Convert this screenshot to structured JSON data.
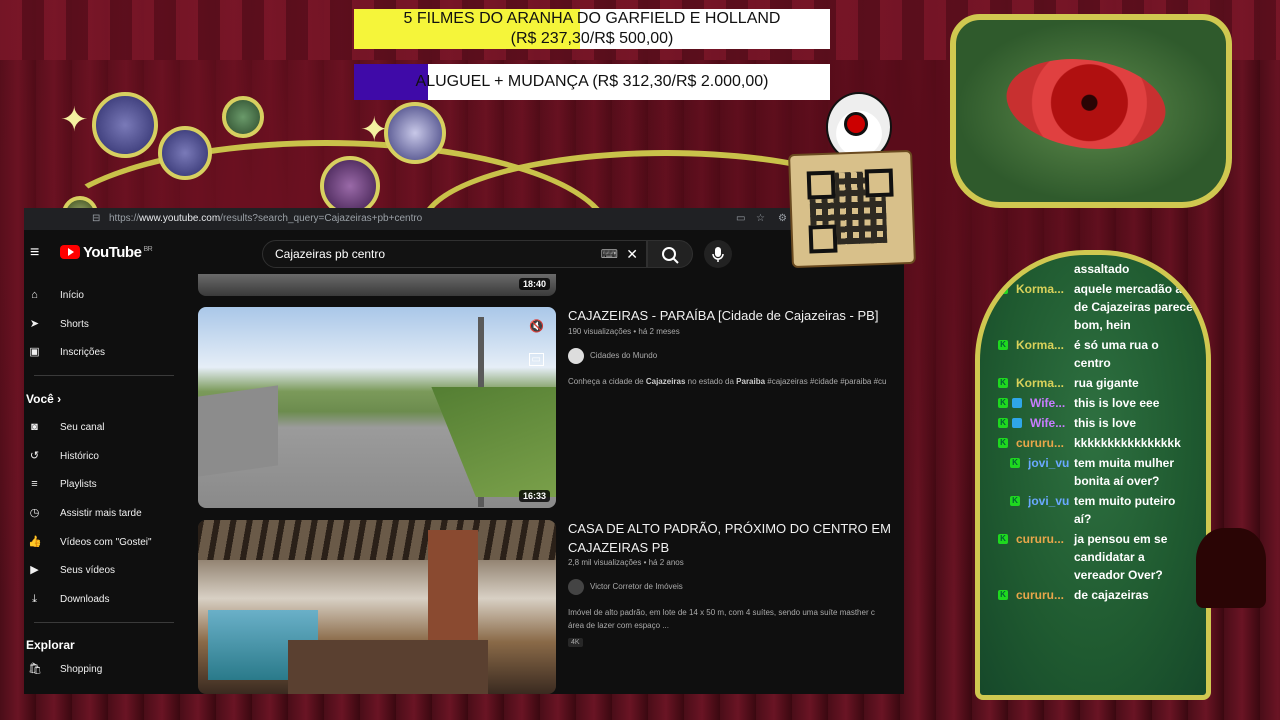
{
  "goals": [
    {
      "line1": "5 FILMES DO ARANHA DO GARFIELD E HOLLAND",
      "line2": "(R$ 237,30/R$ 500,00)",
      "progress": 0.4746,
      "color": "#f5f53a"
    },
    {
      "line1": "ALUGUEL + MUDANÇA (R$ 312,30/R$ 2.000,00)",
      "progress": 0.156,
      "color": "#3f0aa8"
    }
  ],
  "browser": {
    "url_prefix": "https://",
    "url_host": "www.youtube.com",
    "url_path": "/results?search_query=Cajazeiras+pb+centro"
  },
  "youtube": {
    "logo": "YouTube",
    "region": "BR",
    "search_value": "Cajazeiras pb centro",
    "sidebar": [
      {
        "icon": "home-icon",
        "glyph": "⌂",
        "label": "Início"
      },
      {
        "icon": "shorts-icon",
        "glyph": "➤",
        "label": "Shorts"
      },
      {
        "icon": "subscriptions-icon",
        "glyph": "▣",
        "label": "Inscrições"
      }
    ],
    "you_header": "Você",
    "you_items": [
      {
        "icon": "channel-icon",
        "glyph": "◙",
        "label": "Seu canal"
      },
      {
        "icon": "history-icon",
        "glyph": "↺",
        "label": "Histórico"
      },
      {
        "icon": "playlists-icon",
        "glyph": "≡",
        "label": "Playlists"
      },
      {
        "icon": "watch-later-icon",
        "glyph": "◷",
        "label": "Assistir mais tarde"
      },
      {
        "icon": "liked-icon",
        "glyph": "👍",
        "label": "Vídeos com \"Gostei\""
      },
      {
        "icon": "your-videos-icon",
        "glyph": "▶",
        "label": "Seus vídeos"
      },
      {
        "icon": "downloads-icon",
        "glyph": "⤓",
        "label": "Downloads"
      }
    ],
    "explore_header": "Explorar",
    "explore_items": [
      {
        "icon": "shopping-icon",
        "glyph": "🛍",
        "label": "Shopping"
      }
    ],
    "prev_duration": "18:40",
    "videos": [
      {
        "title": "CAJAZEIRAS - PARAÍBA [Cidade de Cajazeiras - PB]",
        "meta": "190 visualizações • há 2 meses",
        "channel": "Cidades do Mundo",
        "desc_pre": "Conheça a cidade de ",
        "desc_b1": "Cajazeiras",
        "desc_mid": " no estado da ",
        "desc_b2": "Paraiba",
        "desc_post": " #cajazeiras #cidade #paraiba #cu",
        "duration": "16:33"
      },
      {
        "title": "CASA DE ALTO PADRÃO, PRÓXIMO DO CENTRO EM CAJAZEIRAS PB",
        "meta": "2,8 mil visualizações • há 2 anos",
        "channel": "Victor Corretor de Imóveis",
        "desc_line1": "Imóvel de alto padrão, em lote de 14 x 50 m, com 4 suítes, sendo uma suíte masther c",
        "desc_line2": "área de lazer com espaço ...",
        "badge": "4K"
      }
    ]
  },
  "chat": [
    {
      "user": "",
      "text": "assaltado",
      "badges": 0,
      "color": "#ffffff"
    },
    {
      "user": "Korma...",
      "text": "aquele mercadão ali de Cajazeiras parece bom, hein",
      "badges": 1,
      "color": "#d9d15a"
    },
    {
      "user": "Korma...",
      "text": "é só uma rua o centro",
      "badges": 1,
      "color": "#d9d15a"
    },
    {
      "user": "Korma...",
      "text": "rua gigante",
      "badges": 1,
      "color": "#d9d15a"
    },
    {
      "user": "Wife...",
      "text": "this is love eee",
      "badges": 2,
      "color": "#c77dff"
    },
    {
      "user": "Wife...",
      "text": "this is love",
      "badges": 2,
      "color": "#c77dff"
    },
    {
      "user": "cururu...",
      "text": "kkkkkkkkkkkkkkkk",
      "badges": 1,
      "color": "#e8a64a"
    },
    {
      "user": "jovi_vu",
      "text": "tem muita mulher bonita aí over?",
      "badges": 1,
      "color": "#6aa8ff"
    },
    {
      "user": "jovi_vu",
      "text": "tem muito puteiro aí?",
      "badges": 1,
      "color": "#6aa8ff"
    },
    {
      "user": "cururu...",
      "text": "ja pensou em se candidatar a vereador Over?",
      "badges": 1,
      "color": "#e8a64a"
    },
    {
      "user": "cururu...",
      "text": "de cajazeiras",
      "badges": 1,
      "color": "#e8a64a"
    }
  ]
}
